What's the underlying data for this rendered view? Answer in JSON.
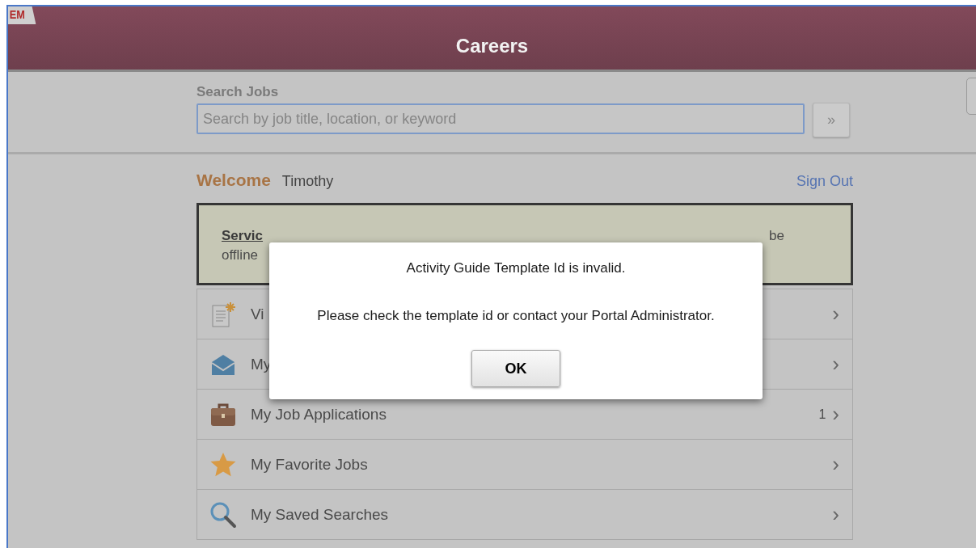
{
  "corner_tab": {
    "label": "EM"
  },
  "header": {
    "title": "Careers"
  },
  "search": {
    "label": "Search Jobs",
    "placeholder": "Search by job title, location, or keyword",
    "button": "»"
  },
  "welcome": {
    "greeting": "Welcome",
    "name": "Timothy",
    "sign_out": "Sign Out"
  },
  "notice": {
    "link": "Servic",
    "line1_end": "be",
    "line2": "offline"
  },
  "menu": [
    {
      "kind": "document",
      "label": "Vi",
      "chevron": "›"
    },
    {
      "kind": "envelope",
      "label": "My",
      "chevron": "›"
    },
    {
      "kind": "briefcase",
      "label": "My Job Applications",
      "count": "1",
      "chevron": "›"
    },
    {
      "kind": "star",
      "label": "My Favorite Jobs",
      "chevron": "›"
    },
    {
      "kind": "magnifier",
      "label": "My Saved Searches",
      "chevron": "›"
    }
  ],
  "dialog": {
    "message": "Activity Guide Template Id is invalid.",
    "detail": "Please check the template id or contact your Portal Administrator.",
    "button": "OK"
  }
}
